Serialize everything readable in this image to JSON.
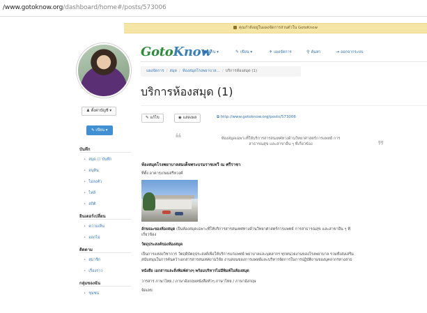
{
  "browser": {
    "url_domain": "/www.gotoknow.org",
    "url_path": "/dashboard/home#/posts/573006"
  },
  "notice": {
    "text": "คุณกำลังอยู่ในแผงจัดการส่วนตัวใน GotoKnow"
  },
  "sidebar": {
    "user_menu_label": "ตั้งค่าบัญชี ▾",
    "write_button_label": "เขียน ▾",
    "sections": [
      {
        "title": "บันทึก",
        "items": [
          "สมุด ☐ บันทึก",
          "อนุทิน",
          "ไม่ลงตัว",
          "ไฟล์",
          "สถิติ"
        ]
      },
      {
        "title": "อินเตอร์เปลี่ยน",
        "items": [
          "ความเห็น",
          "ออกไม่"
        ]
      },
      {
        "title": "ติดตาม",
        "items": [
          "สมาชิก",
          "เรื่องราว"
        ]
      },
      {
        "title": "กลุ่มของฉัน",
        "items": [
          "ชุมชน"
        ]
      }
    ]
  },
  "nav": {
    "logo_part1": "Goto",
    "logo_part2": "Know",
    "items": [
      {
        "icon": "●",
        "label": "อ่าน ▾"
      },
      {
        "icon": "✎",
        "label": "เขียน ▾"
      },
      {
        "icon": "✈",
        "label": "แผงจัดการ"
      },
      {
        "icon": "⚲",
        "label": "ค้นหา"
      },
      {
        "icon": "⇥",
        "label": "ออกจากระบบ"
      }
    ]
  },
  "breadcrumb": {
    "item1": "แผงจัดการ",
    "item2": "สมุด",
    "item3": "ห้องสมุดโรงพยาบาล...",
    "current": "บริการห้องสมุด (1)"
  },
  "post": {
    "title": "บริการห้องสมุด (1)",
    "edit_label": "แก้ไข",
    "view_label": "แสดงผล",
    "permalink": "http://www.gotoknow.org/posts/573006",
    "quote_line1": "ห้องสมุดเฉพาะที่ให้บริการสารสนเทศทางด้านวิทยาศาสตร์การแพทย์ การ",
    "quote_line2": "สาธารณสุข และสาขาอื่น ๆ ที่เกี่ยวข้อง",
    "heading": "ห้องสมุดโรงพยาบาลสมเด็จพระบรมราชเทวี ณ ศรีราชา",
    "location": "ที่ตั้ง อาคารเกษมสรีหวงค์",
    "p1_bold": "ลักษณะของห้องสมุด",
    "p1_text": " เป็นห้องสมุดเฉพาะที่ให้บริการสารสนเทศทางด้านวิทยาศาสตร์การแพทย์ การสาธารณสุข และสาขาอื่น ๆ ที่",
    "p1_cont": "เกี่ยวข้อง",
    "sub2": "วัตถุประสงค์ของห้องสมุด",
    "p2_line1": "เป็นการแหล่งวิชาการ วัตถุดิบัตถุประสงค์เพื่อให้บริการแก่แพทย์ พยาบาลและบุคลากร ทุกหน่วยงานของโรงพยาบาล รวมทั้งส่งเสริม",
    "p2_line2": "สนับสนุนในการค้นคว้าเอกสารสารสนเทศงานวิจัย งานสอนของการแพทย์และบริหารจัดการในการปฏิบัติงานของบุคลากรทางสาธ",
    "sub3": "หนังสือ เอกสารและสิ่งพิมพ์ต่างๆ พร้อมบริหารไม่มีพิมพ์ในห้องสมุด",
    "p3_line1": "วารสาร ภาษาไทย / ภาษาอังกฤษหนังสือทั่วๆ ภาษาไทย / ภาษาอังกฤษ",
    "p3_line2": "จัดเลข"
  }
}
